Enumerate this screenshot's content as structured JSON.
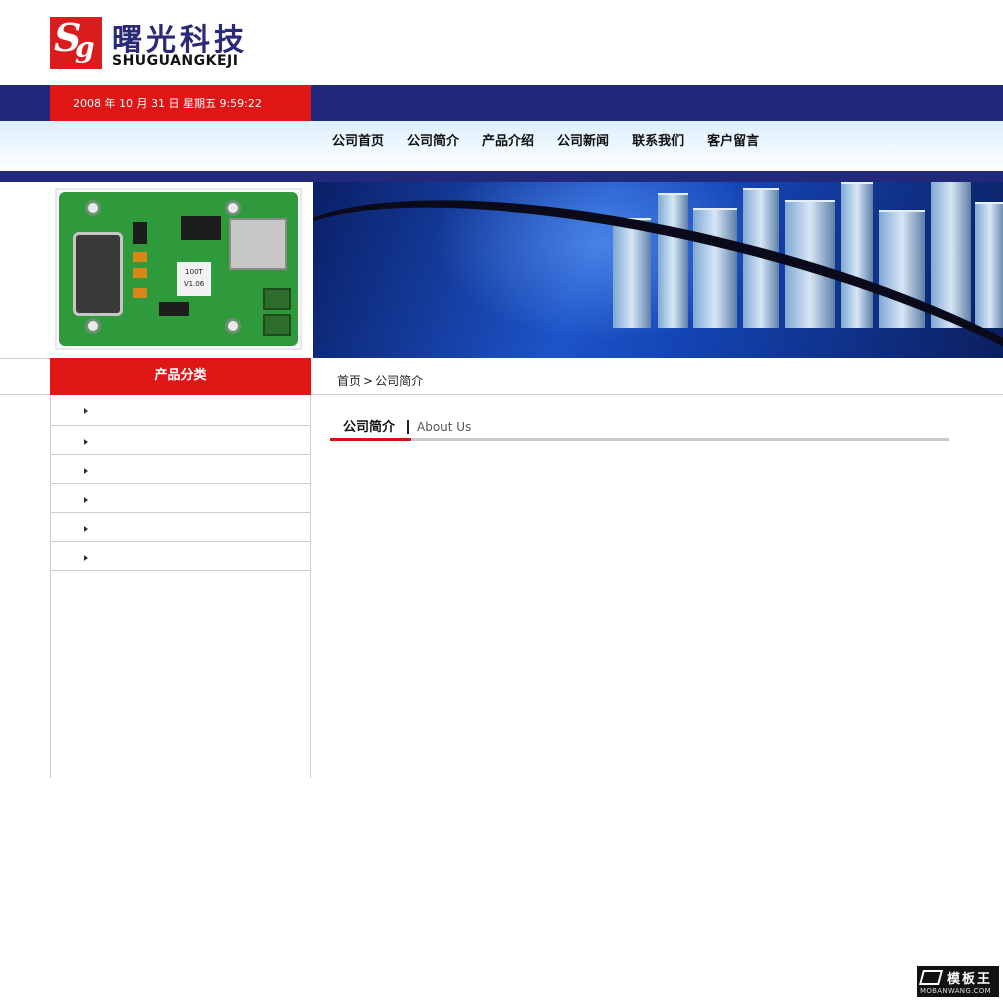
{
  "header": {
    "logo_mark_s": "S",
    "logo_mark_g": "g",
    "logo_cn": "曙光科技",
    "logo_en": "SHUGUANGKEJI",
    "datetime": "2008 年 10 月 31 日 星期五 9:59:22"
  },
  "nav": {
    "items": [
      "公司首页",
      "公司简介",
      "产品介绍",
      "公司新闻",
      "联系我们",
      "客户留言"
    ]
  },
  "product_image": {
    "label_line1": "100T",
    "label_line2": "V1.06"
  },
  "sidebar": {
    "title": "产品分类",
    "items": [
      "",
      "",
      "",
      "",
      "",
      ""
    ]
  },
  "breadcrumb": {
    "home": "首页",
    "separator": ">",
    "current": "公司简介"
  },
  "section": {
    "title_cn": "公司简介",
    "title_en": "About Us"
  },
  "watermark": {
    "cn": "模板王",
    "en": "MOBANWANG.COM"
  },
  "colors": {
    "navy": "#22287a",
    "red": "#de1616",
    "nav_gradient_top": "#dceffd"
  }
}
